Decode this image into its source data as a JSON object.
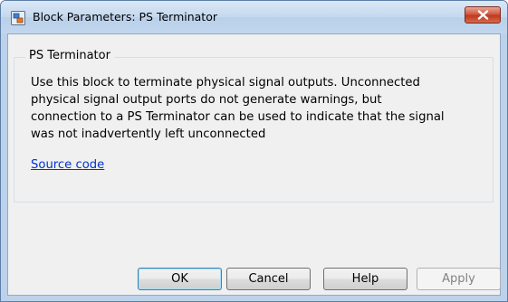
{
  "window": {
    "title": "Block Parameters: PS Terminator"
  },
  "block": {
    "name": "PS Terminator",
    "description_lines": [
      "Use this block to terminate physical signal outputs. Unconnected",
      "physical signal output ports do not generate warnings, but",
      "connection to a PS Terminator can be used to indicate that the signal",
      "was not inadvertently left unconnected"
    ],
    "source_link": "Source code"
  },
  "buttons": {
    "ok": "OK",
    "cancel": "Cancel",
    "help": "Help",
    "apply": "Apply"
  },
  "icons": {
    "title": "simulink-block-icon",
    "close": "close-icon"
  },
  "colors": {
    "close_button": "#c7432a",
    "link": "#0033cc",
    "disabled_text": "#838383"
  }
}
